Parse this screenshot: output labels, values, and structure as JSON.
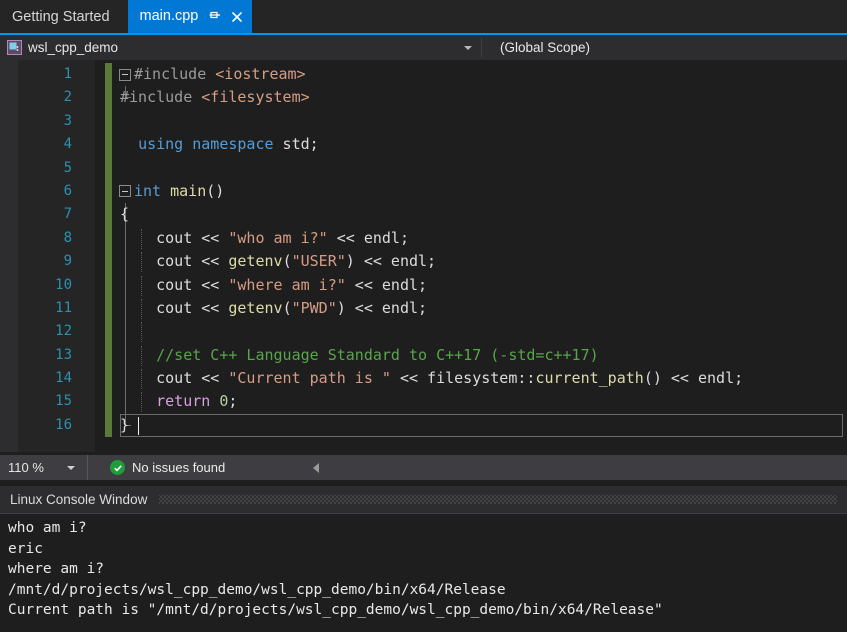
{
  "tabs": [
    {
      "label": "Getting Started",
      "active": false
    },
    {
      "label": "main.cpp",
      "active": true
    }
  ],
  "tab_icons": {
    "pin": "pin-icon",
    "close": "close-icon"
  },
  "navbar": {
    "project": "wsl_cpp_demo",
    "project_icon": "cpp-project-icon",
    "scope": "(Global Scope)",
    "dropdown_icon": "chevron-down-icon",
    "accent_color": "#0097e6"
  },
  "editor": {
    "zoom": "110 %",
    "lines": [
      {
        "n": "1",
        "tokens": [
          {
            "t": "#include ",
            "c": "pp"
          },
          {
            "t": "<iostream>",
            "c": "inc"
          }
        ]
      },
      {
        "n": "2",
        "tokens": [
          {
            "t": "#include ",
            "c": "pp"
          },
          {
            "t": "<filesystem>",
            "c": "inc"
          }
        ]
      },
      {
        "n": "3",
        "tokens": []
      },
      {
        "n": "4",
        "tokens": [
          {
            "t": "  ",
            "c": "pl"
          },
          {
            "t": "using",
            "c": "kw"
          },
          {
            "t": " ",
            "c": "pl"
          },
          {
            "t": "namespace",
            "c": "kw"
          },
          {
            "t": " std;",
            "c": "pl"
          }
        ]
      },
      {
        "n": "5",
        "tokens": []
      },
      {
        "n": "6",
        "tokens": [
          {
            "t": "int",
            "c": "kw"
          },
          {
            "t": " ",
            "c": "pl"
          },
          {
            "t": "main",
            "c": "fn"
          },
          {
            "t": "()",
            "c": "pl"
          }
        ]
      },
      {
        "n": "7",
        "tokens": [
          {
            "t": "{",
            "c": "pl"
          }
        ]
      },
      {
        "n": "8",
        "tokens": [
          {
            "t": "    cout << ",
            "c": "pl"
          },
          {
            "t": "\"who am i?\"",
            "c": "str"
          },
          {
            "t": " << endl;",
            "c": "pl"
          }
        ]
      },
      {
        "n": "9",
        "tokens": [
          {
            "t": "    cout << ",
            "c": "pl"
          },
          {
            "t": "getenv",
            "c": "fn"
          },
          {
            "t": "(",
            "c": "pl"
          },
          {
            "t": "\"USER\"",
            "c": "str"
          },
          {
            "t": ") << endl;",
            "c": "pl"
          }
        ]
      },
      {
        "n": "10",
        "tokens": [
          {
            "t": "    cout << ",
            "c": "pl"
          },
          {
            "t": "\"where am i?\"",
            "c": "str"
          },
          {
            "t": " << endl;",
            "c": "pl"
          }
        ]
      },
      {
        "n": "11",
        "tokens": [
          {
            "t": "    cout << ",
            "c": "pl"
          },
          {
            "t": "getenv",
            "c": "fn"
          },
          {
            "t": "(",
            "c": "pl"
          },
          {
            "t": "\"PWD\"",
            "c": "str"
          },
          {
            "t": ") << endl;",
            "c": "pl"
          }
        ]
      },
      {
        "n": "12",
        "tokens": []
      },
      {
        "n": "13",
        "tokens": [
          {
            "t": "    ",
            "c": "pl"
          },
          {
            "t": "//set C++ Language Standard to C++17 (-std=c++17)",
            "c": "cmt"
          }
        ]
      },
      {
        "n": "14",
        "tokens": [
          {
            "t": "    cout << ",
            "c": "pl"
          },
          {
            "t": "\"Current path is \"",
            "c": "str"
          },
          {
            "t": " << filesystem::",
            "c": "pl"
          },
          {
            "t": "current_path",
            "c": "fn"
          },
          {
            "t": "() << endl;",
            "c": "pl"
          }
        ]
      },
      {
        "n": "15",
        "tokens": [
          {
            "t": "    ",
            "c": "pl"
          },
          {
            "t": "return",
            "c": "kwp"
          },
          {
            "t": " ",
            "c": "pl"
          },
          {
            "t": "0",
            "c": "num"
          },
          {
            "t": ";",
            "c": "pl"
          }
        ]
      },
      {
        "n": "16",
        "tokens": [
          {
            "t": "}",
            "c": "pl"
          }
        ]
      }
    ]
  },
  "status": {
    "zoom": "110 %",
    "issues_text": "No issues found",
    "issues_icon": "check-circle-icon",
    "collapse_icon": "left-triangle-icon"
  },
  "console": {
    "title": "Linux Console Window",
    "lines": [
      "who am i?",
      "eric",
      "where am i?",
      "/mnt/d/projects/wsl_cpp_demo/wsl_cpp_demo/bin/x64/Release",
      "Current path is \"/mnt/d/projects/wsl_cpp_demo/wsl_cpp_demo/bin/x64/Release\""
    ]
  }
}
